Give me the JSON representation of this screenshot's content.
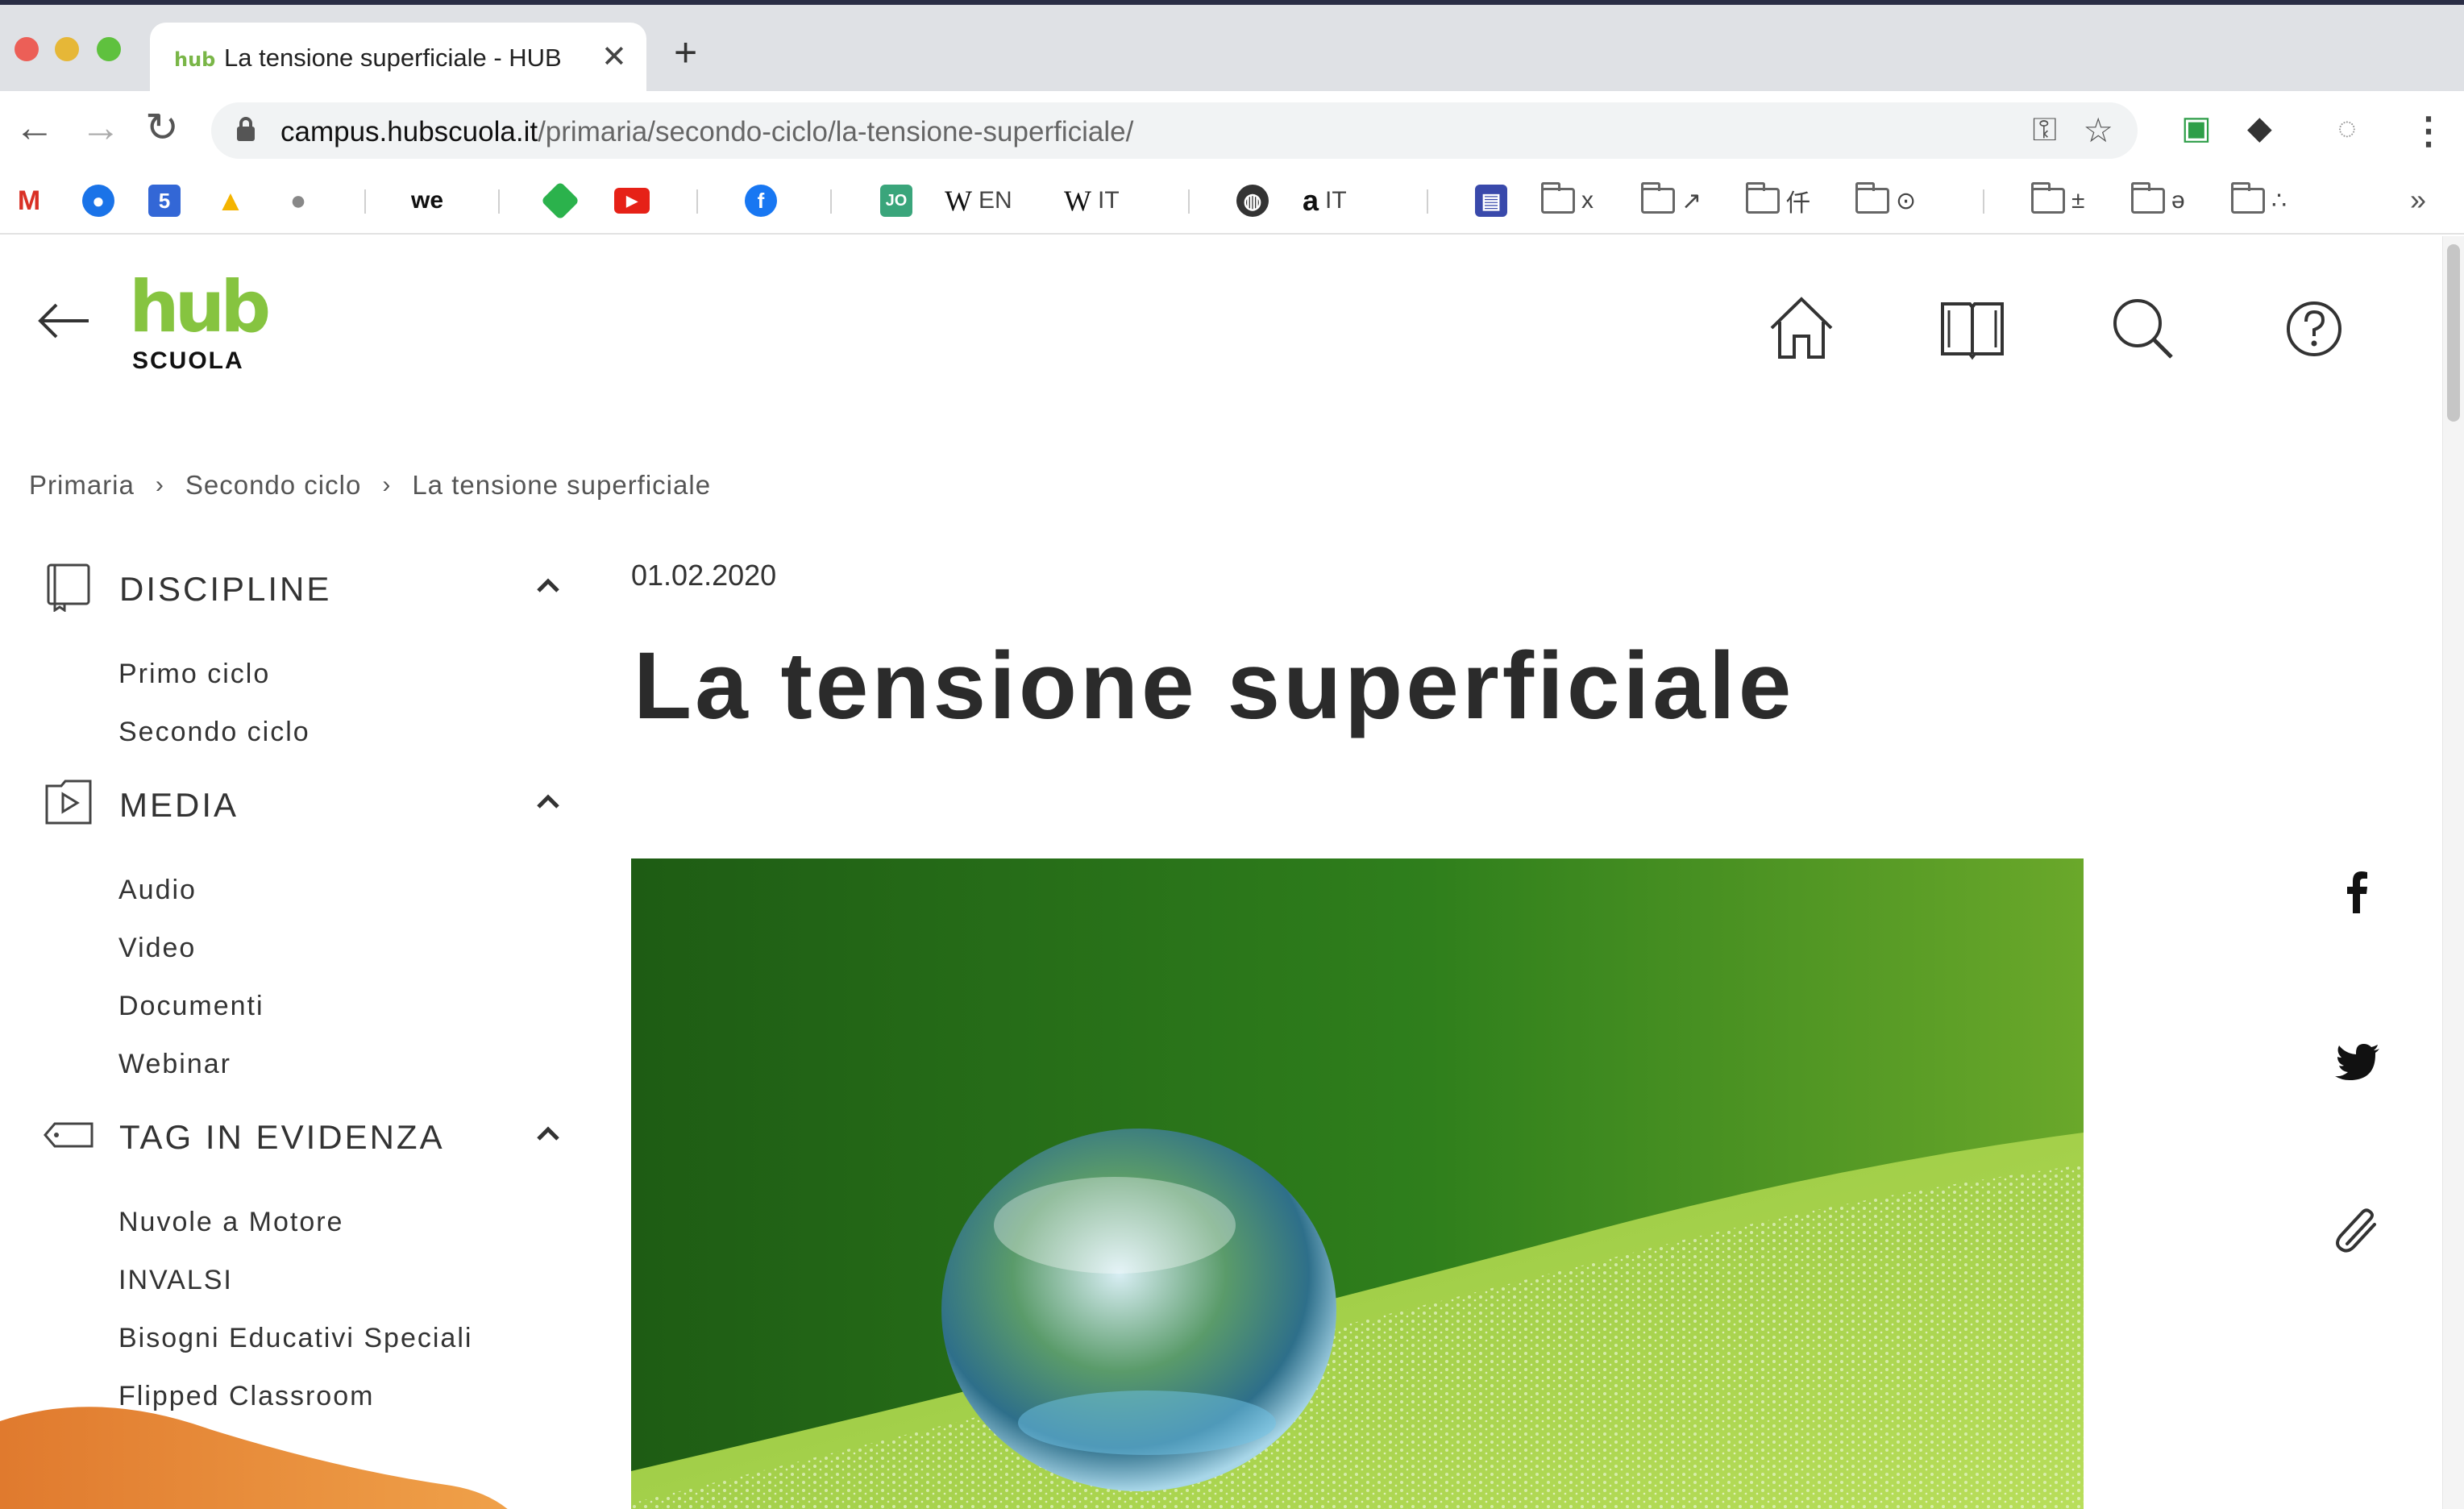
{
  "browser": {
    "tab": {
      "favicon_text": "hub",
      "title": "La tensione superficiale - HUB"
    },
    "url": {
      "host": "campus.hubscuola.it",
      "path": "/primaria/secondo-ciclo/la-tensione-superficiale/"
    },
    "bookmarks": {
      "we_label": "we",
      "wiki_en_label": "EN",
      "wiki_it_label": "IT",
      "amazon_label": "IT",
      "folder_1": "x",
      "folder_2": "↗",
      "folder_3": "仟",
      "folder_4": "⊙",
      "folder_5": "±",
      "folder_6": "ə",
      "folder_7": "∴"
    }
  },
  "site": {
    "logo": {
      "hub": "hub",
      "scuola": "SCUOLA"
    },
    "breadcrumb": [
      "Primaria",
      "Secondo ciclo",
      "La tensione superficiale"
    ]
  },
  "sidebar": {
    "sections": [
      {
        "title": "DISCIPLINE",
        "icon": "book-icon",
        "items": [
          "Primo ciclo",
          "Secondo ciclo"
        ]
      },
      {
        "title": "MEDIA",
        "icon": "media-play-icon",
        "items": [
          "Audio",
          "Video",
          "Documenti",
          "Webinar"
        ]
      },
      {
        "title": "TAG IN EVIDENZA",
        "icon": "tag-icon",
        "items": [
          "Nuvole a Motore",
          "INVALSI",
          "Bisogni Educativi Speciali",
          "Flipped Classroom"
        ]
      }
    ]
  },
  "article": {
    "date": "01.02.2020",
    "title": "La tensione superficiale"
  },
  "colors": {
    "brand_green": "#86c440",
    "accent_orange": "#e8903a"
  }
}
